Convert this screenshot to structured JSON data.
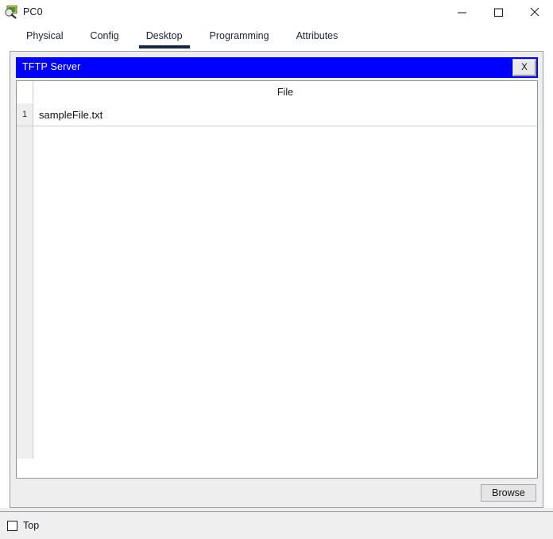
{
  "window": {
    "title": "PC0",
    "icon": "packet-tracer-device-icon",
    "controls": {
      "minimize": "–",
      "maximize": "□",
      "close": "✕"
    }
  },
  "tabs": [
    {
      "label": "Physical",
      "active": false
    },
    {
      "label": "Config",
      "active": false
    },
    {
      "label": "Desktop",
      "active": true
    },
    {
      "label": "Programming",
      "active": false
    },
    {
      "label": "Attributes",
      "active": false
    }
  ],
  "dialog": {
    "title": "TFTP Server",
    "close_label": "X",
    "titlebar_color": "#0000ff",
    "table": {
      "columns": [
        "File"
      ],
      "rows": [
        {
          "num": "1",
          "file": "sampleFile.txt"
        }
      ]
    },
    "browse_label": "Browse"
  },
  "bottom": {
    "top_checkbox_label": "Top",
    "top_checkbox_checked": false
  }
}
